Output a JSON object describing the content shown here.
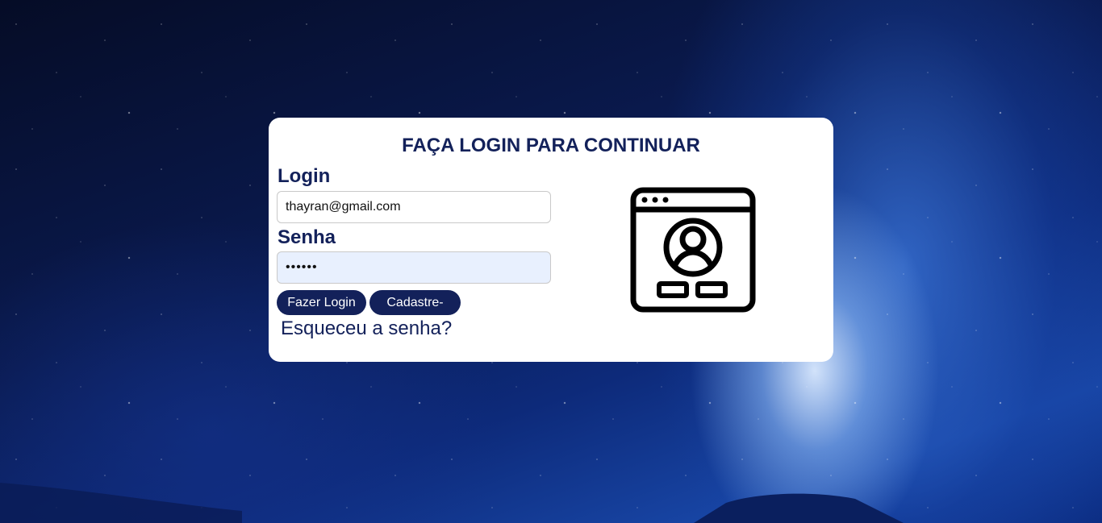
{
  "card": {
    "title": "FAÇA LOGIN PARA CONTINUAR"
  },
  "form": {
    "login_label": "Login",
    "login_value": "thayran@gmail.com",
    "password_label": "Senha",
    "password_value": "••••••",
    "login_button": "Fazer Login",
    "signup_button": "Cadastre-se",
    "forgot_link": "Esqueceu a senha?"
  },
  "icons": {
    "illustration": "browser-user-profile-icon"
  },
  "colors": {
    "accent": "#13215a",
    "card_background": "#ffffff",
    "autofill_background": "#e8f0fe"
  }
}
